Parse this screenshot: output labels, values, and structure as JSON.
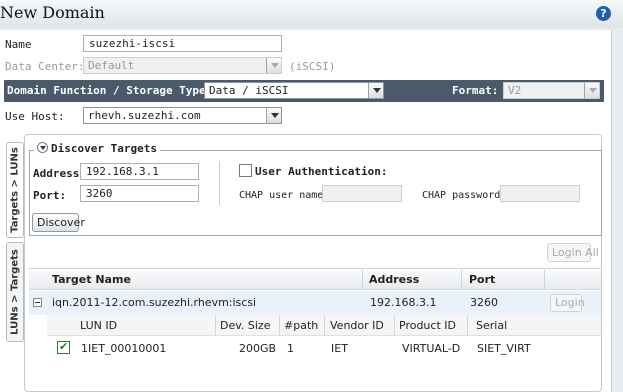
{
  "dialog": {
    "title": "New Domain",
    "help_icon": "help-icon"
  },
  "form": {
    "name_label": "Name",
    "name_value": "suzezhi-iscsi",
    "data_center_label": "Data Center:",
    "data_center_value": "Default",
    "data_center_suffix": "(iSCSI)",
    "domain_function_label": "Domain Function / Storage Type:",
    "domain_function_value": "Data  / iSCSI",
    "format_label": "Format:",
    "format_value": "V2",
    "use_host_label": "Use Host:",
    "use_host_value": "rhevh.suzezhi.com"
  },
  "side_tabs": {
    "targets_luns": "Targets > LUNs",
    "luns_targets": "LUNs > Targets"
  },
  "discover": {
    "legend": "Discover Targets",
    "address_label": "Address:",
    "address_value": "192.168.3.1",
    "port_label": "Port:",
    "port_value": "3260",
    "user_auth_label": "User Authentication:",
    "chap_user_label": "CHAP user name:",
    "chap_password_label": "CHAP password:",
    "discover_button": "Discover"
  },
  "targets": {
    "login_all_button": "Login All",
    "columns": [
      "Target Name",
      "Address",
      "Port"
    ],
    "rows": [
      {
        "name": "iqn.2011-12.com.suzezhi.rhevm:iscsi",
        "address": "192.168.3.1",
        "port": "3260",
        "login_button": "Login"
      }
    ]
  },
  "luns": {
    "columns": [
      "LUN ID",
      "Dev. Size",
      "#path",
      "Vendor ID",
      "Product ID",
      "Serial"
    ],
    "rows": [
      {
        "checked": true,
        "lun_id": "1IET_00010001",
        "dev_size": "200GB",
        "path": "1",
        "vendor": "IET",
        "product": "VIRTUAL-D",
        "serial": "SIET_VIRT"
      }
    ]
  }
}
